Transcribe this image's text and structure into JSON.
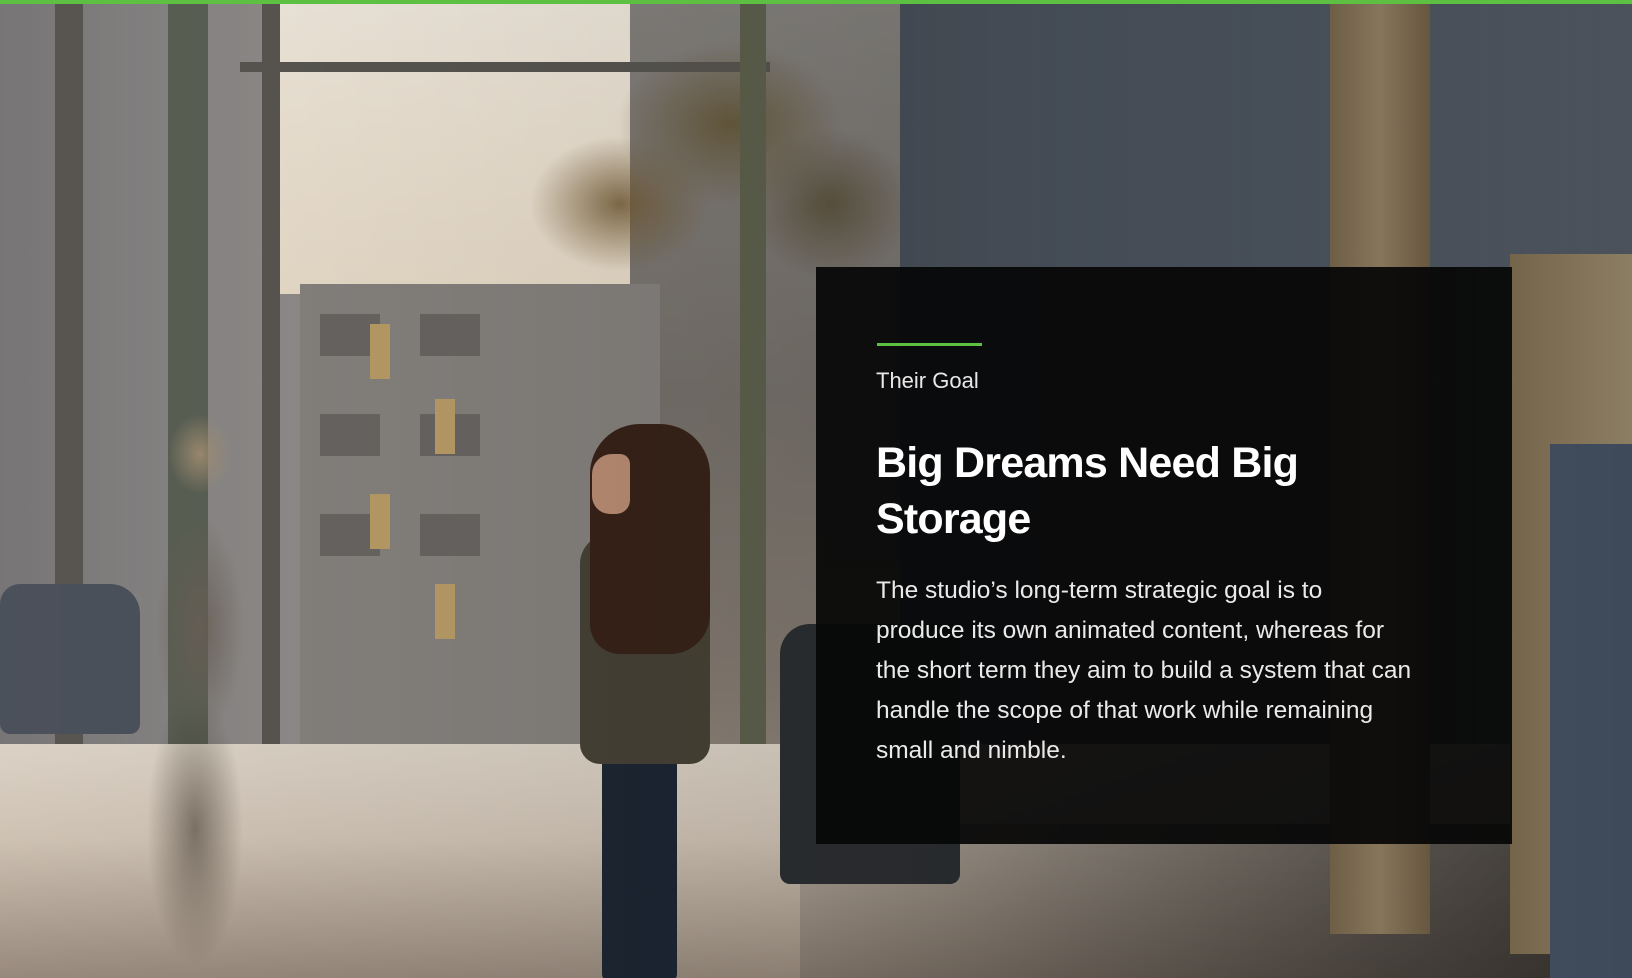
{
  "colors": {
    "accent": "#5ec043",
    "panel_bg": "#060606",
    "headline_text": "#ffffff",
    "body_text": "#eaeaea"
  },
  "info_panel": {
    "eyebrow": "Their Goal",
    "headline": "Big Dreams Need Big Storage",
    "body": "The studio’s long-term strategic goal is to produce its own animated content, whereas for the short term they aim to build a system that can handle the scope of that work while remaining small and nimble."
  }
}
